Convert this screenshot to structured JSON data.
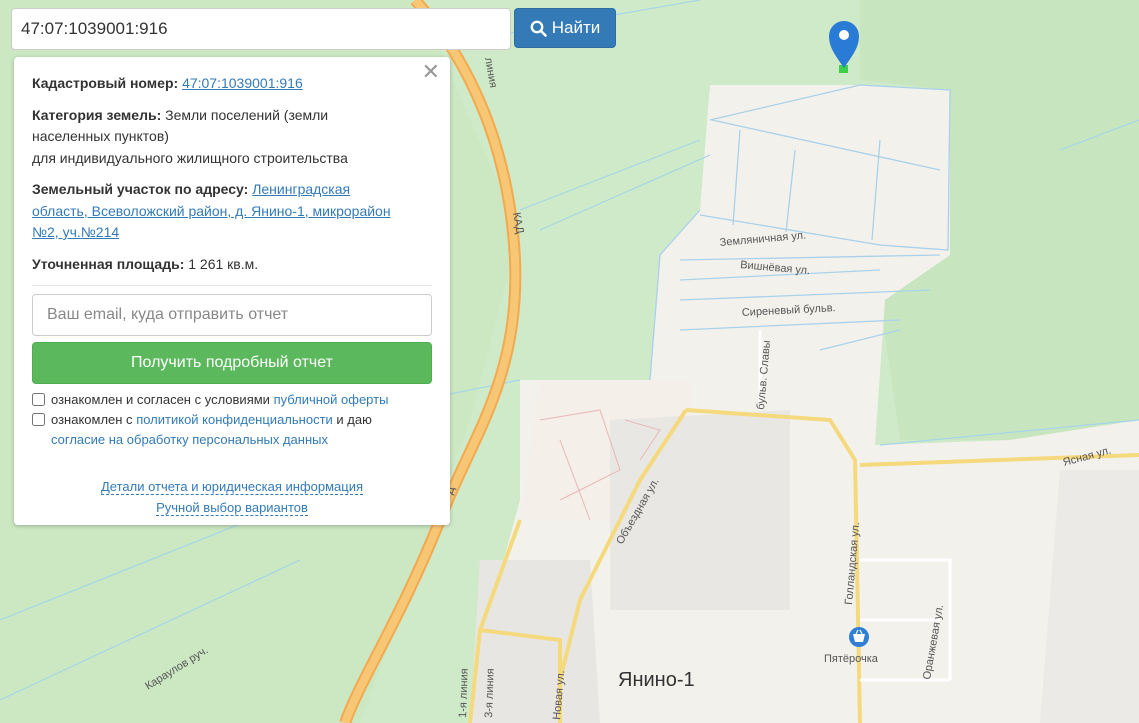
{
  "search": {
    "value": "47:07:1039001:916",
    "button_label": "Найти"
  },
  "panel": {
    "cadastral_label": "Кадастровый номер:",
    "cadastral_value": "47:07:1039001:916",
    "category_label": "Категория земель:",
    "category_value_1": "Земли поселений (земли",
    "category_value_2": "населенных пунктов)",
    "category_value_3": "для индивидуального жилищного строительства",
    "address_label": "Земельный участок по адресу:",
    "address_value_1": "Ленинградская",
    "address_value_2": "область, Всеволожский район, д. Янино-1, микрорайон",
    "address_value_3": "№2, уч.№214",
    "area_label": "Уточненная площадь:",
    "area_value": "1 261 кв.м.",
    "email_placeholder": "Ваш email, куда отправить отчет",
    "report_button": "Получить подробный отчет",
    "check1_text": "ознакомлен и согласен с условиями",
    "check1_link": "публичной оферты",
    "check2_text": "ознакомлен с",
    "check2_link": "политикой конфиденциальности",
    "check2_text2": "и даю",
    "check2_link2": "согласие на обработку персональных данных",
    "footer_link1": "Детали отчета и юридическая информация",
    "footer_link2": "Ручной выбор вариантов"
  },
  "map": {
    "labels": {
      "kad": "КАД",
      "kad2": "Д",
      "street_zemlyanichnaya": "Земляничная ул.",
      "street_vishnevaya": "Вишнёвая ул.",
      "street_sirenevy": "Сиреневый бульв.",
      "street_slavy": "бульв. Славы",
      "street_yasnaya": "Ясная ул.",
      "street_obezdnaya": "Объездная ул.",
      "street_gollandskaya": "Голландская ул.",
      "street_oranzhevaya": "Оранжевая ул.",
      "street_novaya": "Новая ул.",
      "street_liniya": "линия",
      "street_1liniya": "1-я линия",
      "street_3liniya": "3-я линия",
      "street_karaulov": "Караулов руч.",
      "town": "Янино-1",
      "shop": "Пятёрочка"
    },
    "colors": {
      "forest": "#c9e8c2",
      "field": "#e6efdf",
      "urban": "#f4f2ee",
      "road_main": "#f6b965",
      "road_minor": "#f7dd8a",
      "water": "#9fd0e8",
      "marker": "#2a7bd5"
    }
  }
}
